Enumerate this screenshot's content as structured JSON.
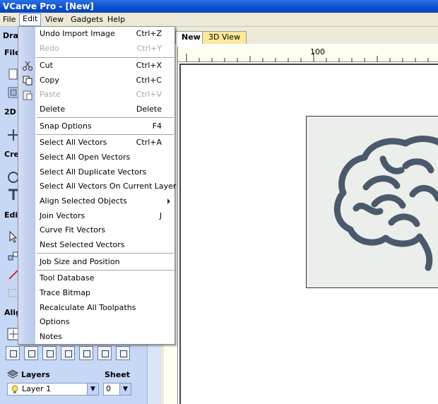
{
  "window": {
    "title": "VCarve Pro - [New]"
  },
  "menubar": {
    "file": "File",
    "edit": "Edit",
    "view": "View",
    "gadgets": "Gadgets",
    "help": "Help"
  },
  "left_panel": {
    "drawing_header": "Draw",
    "file_header": "File",
    "view_header": "2D",
    "create_header": "Crea",
    "edit_header": "Edit",
    "align_header": "Alig",
    "layers_label": "Layers",
    "sheet_label": "Sheet",
    "layer_value": "Layer 1",
    "sheet_value": "0"
  },
  "tabs": {
    "new": "New",
    "view3d": "3D View"
  },
  "ruler": {
    "mark": "100"
  },
  "edit_menu": {
    "undo": {
      "label": "Undo Import Image",
      "shortcut": "Ctrl+Z"
    },
    "redo": {
      "label": "Redo",
      "shortcut": "Ctrl+Y"
    },
    "cut": {
      "label": "Cut",
      "shortcut": "Ctrl+X"
    },
    "copy": {
      "label": "Copy",
      "shortcut": "Ctrl+C"
    },
    "paste": {
      "label": "Paste",
      "shortcut": "Ctrl+V"
    },
    "delete": {
      "label": "Delete",
      "shortcut": "Delete"
    },
    "snap_options": {
      "label": "Snap Options",
      "shortcut": "F4"
    },
    "select_all_vectors": {
      "label": "Select All Vectors",
      "shortcut": "Ctrl+A"
    },
    "select_all_open": {
      "label": "Select All Open Vectors"
    },
    "select_all_duplicate": {
      "label": "Select All Duplicate Vectors"
    },
    "select_all_current_layer": {
      "label": "Select All Vectors On Current Layer"
    },
    "align_selected": {
      "label": "Align Selected Objects"
    },
    "join_vectors": {
      "label": "Join Vectors",
      "shortcut": "J"
    },
    "curve_fit": {
      "label": "Curve Fit Vectors"
    },
    "nest_selected": {
      "label": "Nest Selected Vectors"
    },
    "job_size": {
      "label": "Job Size and Position"
    },
    "tool_database": {
      "label": "Tool Database"
    },
    "trace_bitmap": {
      "label": "Trace Bitmap"
    },
    "recalculate": {
      "label": "Recalculate All Toolpaths"
    },
    "options": {
      "label": "Options"
    },
    "notes": {
      "label": "Notes"
    }
  },
  "colors": {
    "title_bar": "#0a4fd0",
    "panel": "#c6d8f5",
    "menu_stripe": "#b8c9ec",
    "brain": "#4a5a6c"
  }
}
